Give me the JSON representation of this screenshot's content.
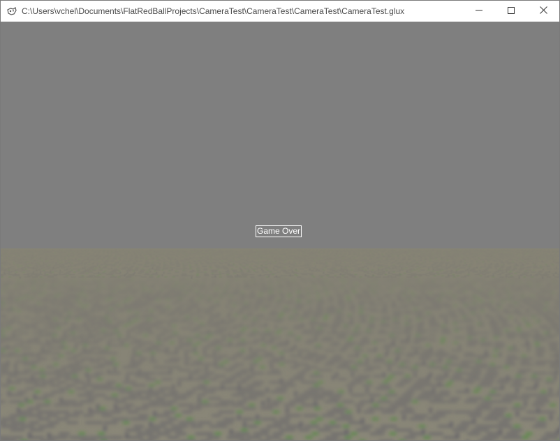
{
  "window": {
    "title": "C:\\Users\\vchel\\Documents\\FlatRedBallProjects\\CameraTest\\CameraTest\\CameraTest\\CameraTest.glux",
    "app_icon": "gamepad-icon",
    "buttons": {
      "minimize_icon": "minimize-icon",
      "maximize_icon": "maximize-icon",
      "close_icon": "close-icon"
    }
  },
  "game": {
    "status_text": "Game Over",
    "colors": {
      "sky": "#7f7f7f",
      "ground": "#858272",
      "path": "#646268",
      "grass": "#3e8a2c",
      "label_border": "#ffffff"
    }
  }
}
